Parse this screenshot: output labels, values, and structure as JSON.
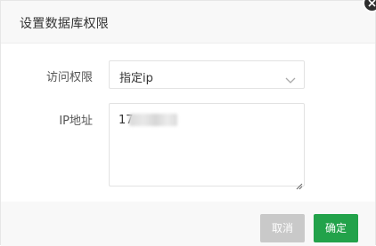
{
  "dialog": {
    "title": "设置数据库权限"
  },
  "form": {
    "access_label": "访问权限",
    "access_value": "指定ip",
    "ip_label": "IP地址",
    "ip_value": "17"
  },
  "footer": {
    "cancel_label": "取消",
    "ok_label": "确定"
  },
  "colors": {
    "primary": "#22a24a",
    "disabled": "#c9c9c9",
    "header_bg": "#f8f8f8"
  },
  "icons": {
    "close": "close-icon",
    "dropdown": "chevron-down-icon",
    "resize": "resize-grip-icon"
  }
}
